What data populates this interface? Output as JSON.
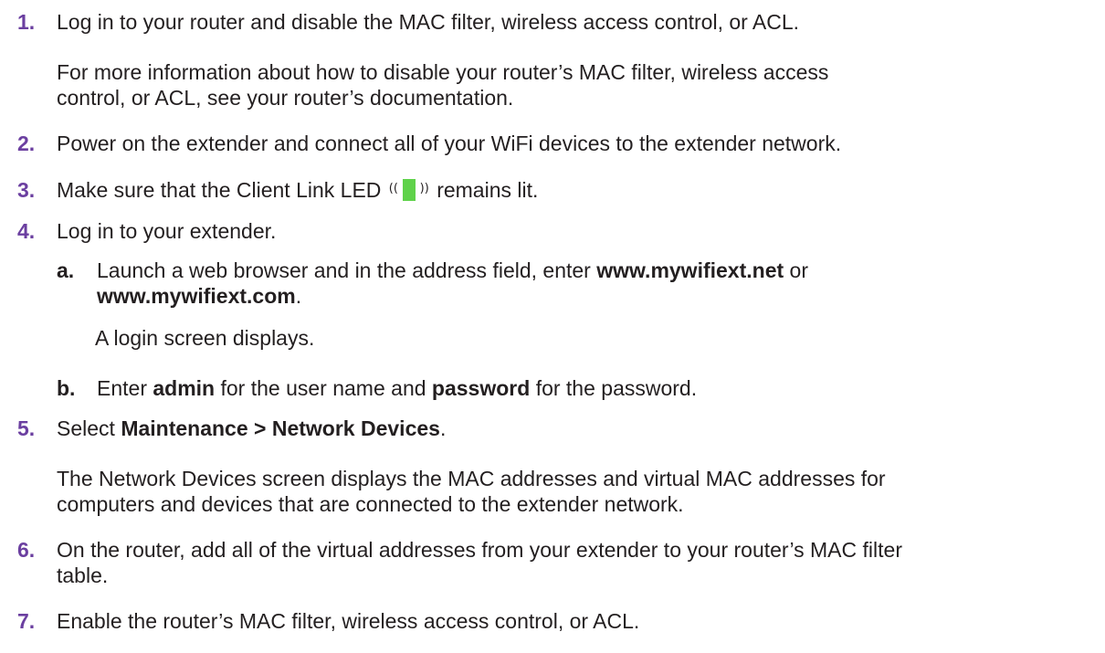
{
  "steps": [
    {
      "number": "1.",
      "text": "Log in to your router and disable the MAC filter, wireless access control, or ACL.",
      "note_lines": [
        "For more information about how to disable your router’s MAC filter, wireless access",
        "control, or ACL, see your router’s documentation."
      ]
    },
    {
      "number": "2.",
      "text": "Power on the extender and connect all of your WiFi devices to the extender network."
    },
    {
      "number": "3.",
      "text_before": "Make sure that the Client Link LED",
      "text_after": "remains lit.",
      "led_icon": "client-link-led-icon",
      "led_color": "#5fd24a"
    },
    {
      "number": "4.",
      "text": "Log in to your extender.",
      "substeps": [
        {
          "letter": "a.",
          "line1": "Launch a web browser and in the address field, enter",
          "url1": "www.mywifiext.net",
          "or": "or",
          "url2": "www.mywifiext.com",
          "period": ".",
          "note": "A login screen displays."
        },
        {
          "letter": "b.",
          "enter": "Enter",
          "user": "admin",
          "mid": "for the user name and",
          "pass": "password",
          "end": "for the password."
        }
      ]
    },
    {
      "number": "5.",
      "select": "Select",
      "menu_path": "Maintenance > Network Devices",
      "period": ".",
      "note_lines": [
        "The Network Devices screen displays the MAC addresses and virtual MAC addresses for",
        "computers and devices that are connected to the extender network."
      ]
    },
    {
      "number": "6.",
      "lines": [
        "On the router, add all of the virtual addresses from your extender to your router’s MAC filter",
        "table."
      ]
    },
    {
      "number": "7.",
      "text": "Enable the router’s MAC filter, wireless access control, or ACL."
    }
  ],
  "colors": {
    "step_number": "#6b3fa0",
    "text": "#231f20"
  }
}
